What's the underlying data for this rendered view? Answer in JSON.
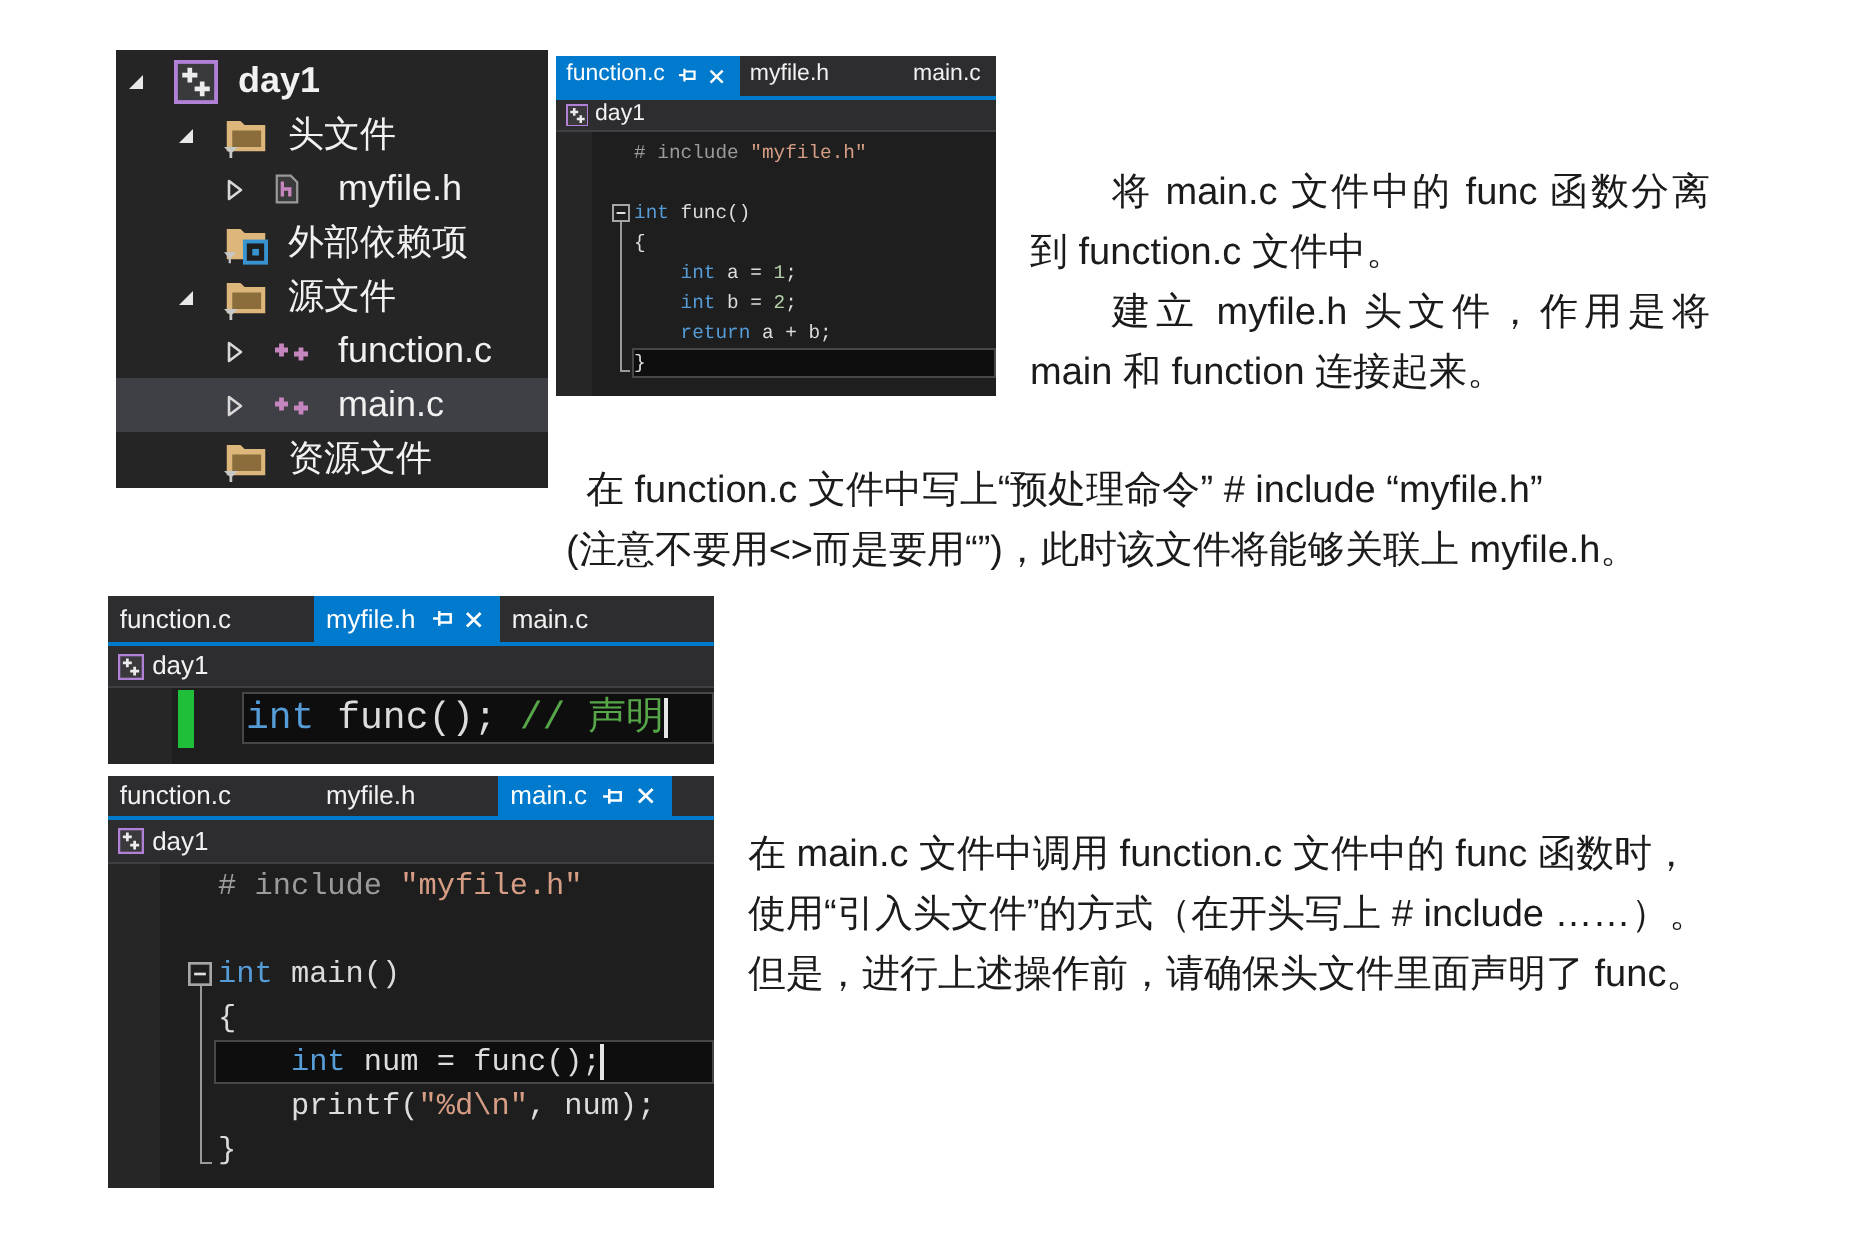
{
  "solution_explorer": {
    "items": [
      {
        "label": "day1",
        "kind": "project",
        "expanded": true,
        "selected": false,
        "children": [
          {
            "label": "头文件",
            "kind": "filter",
            "expanded": true,
            "selected": false,
            "children": [
              {
                "label": "myfile.h",
                "kind": "header",
                "expanded": false,
                "selected": false
              }
            ]
          },
          {
            "label": "外部依赖项",
            "kind": "dependencies",
            "selected": false
          },
          {
            "label": "源文件",
            "kind": "filter",
            "expanded": true,
            "selected": false,
            "children": [
              {
                "label": "function.c",
                "kind": "source",
                "expanded": false,
                "selected": false
              },
              {
                "label": "main.c",
                "kind": "source",
                "expanded": false,
                "selected": true
              }
            ]
          },
          {
            "label": "资源文件",
            "kind": "filter",
            "selected": false
          }
        ]
      }
    ]
  },
  "editors": [
    {
      "tabs": [
        {
          "label": "function.c",
          "selected": true
        },
        {
          "label": "myfile.h",
          "selected": false
        },
        {
          "label": "main.c",
          "selected": false
        }
      ],
      "project": "day1",
      "lines": [
        {
          "kind": "line",
          "tokens": [
            {
              "kind": "preprocessor",
              "text": "# include "
            },
            {
              "kind": "string",
              "text": "\"myfile.h\""
            }
          ],
          "current": false,
          "caret": false,
          "changed": false
        },
        {
          "kind": "blank"
        },
        {
          "kind": "opener",
          "tokens": [
            {
              "kind": "keyword",
              "text": "int"
            },
            {
              "kind": "plain",
              "text": " func()"
            }
          ],
          "current": false,
          "caret": false,
          "changed": false
        },
        {
          "kind": "inner",
          "tokens": [
            {
              "kind": "plain",
              "text": "{"
            }
          ],
          "current": false,
          "caret": false,
          "changed": false
        },
        {
          "kind": "inner",
          "tokens": [
            {
              "kind": "keyword",
              "text": "    int"
            },
            {
              "kind": "plain",
              "text": " a = "
            },
            {
              "kind": "number",
              "text": "1"
            },
            {
              "kind": "plain",
              "text": ";"
            }
          ],
          "current": false,
          "caret": false,
          "changed": false
        },
        {
          "kind": "inner",
          "tokens": [
            {
              "kind": "keyword",
              "text": "    int"
            },
            {
              "kind": "plain",
              "text": " b = "
            },
            {
              "kind": "number",
              "text": "2"
            },
            {
              "kind": "plain",
              "text": ";"
            }
          ],
          "current": false,
          "caret": false,
          "changed": false
        },
        {
          "kind": "inner",
          "tokens": [
            {
              "kind": "keyword",
              "text": "    return"
            },
            {
              "kind": "plain",
              "text": " a + b;"
            }
          ],
          "current": false,
          "caret": false,
          "changed": false
        },
        {
          "kind": "closer",
          "tokens": [
            {
              "kind": "plain",
              "text": "}"
            }
          ],
          "current": true,
          "caret": false,
          "changed": false
        }
      ]
    },
    {
      "tabs": [
        {
          "label": "function.c",
          "selected": false
        },
        {
          "label": "myfile.h",
          "selected": true
        },
        {
          "label": "main.c",
          "selected": false
        }
      ],
      "project": "day1",
      "lines": [
        {
          "kind": "line",
          "tokens": [
            {
              "kind": "keyword",
              "text": "int"
            },
            {
              "kind": "plain",
              "text": " func(); "
            },
            {
              "kind": "comment",
              "text": "// 声明"
            }
          ],
          "current": true,
          "caret": true,
          "changed": true
        }
      ]
    },
    {
      "tabs": [
        {
          "label": "function.c",
          "selected": false
        },
        {
          "label": "myfile.h",
          "selected": false
        },
        {
          "label": "main.c",
          "selected": true
        }
      ],
      "project": "day1",
      "lines": [
        {
          "kind": "line",
          "tokens": [
            {
              "kind": "preprocessor",
              "text": "# include "
            },
            {
              "kind": "string",
              "text": "\"myfile.h\""
            }
          ],
          "current": false,
          "caret": false,
          "changed": false
        },
        {
          "kind": "blank"
        },
        {
          "kind": "opener",
          "tokens": [
            {
              "kind": "keyword",
              "text": "int"
            },
            {
              "kind": "plain",
              "text": " main()"
            }
          ],
          "current": false,
          "caret": false,
          "changed": false
        },
        {
          "kind": "inner",
          "tokens": [
            {
              "kind": "plain",
              "text": "{"
            }
          ],
          "current": false,
          "caret": false,
          "changed": false
        },
        {
          "kind": "inner",
          "tokens": [
            {
              "kind": "keyword",
              "text": "    int"
            },
            {
              "kind": "plain",
              "text": " num = func();"
            }
          ],
          "current": true,
          "caret": true,
          "changed": false
        },
        {
          "kind": "inner",
          "tokens": [
            {
              "kind": "plain",
              "text": "    printf("
            },
            {
              "kind": "string",
              "text": "\"%d\\n\""
            },
            {
              "kind": "plain",
              "text": ", num);"
            }
          ],
          "current": false,
          "caret": false,
          "changed": false
        },
        {
          "kind": "closer",
          "tokens": [
            {
              "kind": "plain",
              "text": "}"
            }
          ],
          "current": false,
          "caret": false,
          "changed": false
        }
      ]
    }
  ],
  "paragraphs": [
    {
      "text": "将 main.c 文件中的 func 函数分离到 function.c 文件中。"
    },
    {
      "text": "建立 myfile.h 头文件，作用是将 main 和 function 连接起来。"
    },
    {
      "lines": [
        "在 function.c 文件中写上“预处理命令” # include “myfile.h”",
        "(注意不要用<>而是要用“”)，此时该文件将能够关联上 myfile.h。"
      ]
    },
    {
      "lines": [
        "在 main.c 文件中调用 function.c 文件中的 func 函数时，",
        "使用“引入头文件”的方式（在开头写上 # include ……）。",
        "但是，进行上述操作前，请确保头文件里面声明了 func。"
      ]
    }
  ]
}
